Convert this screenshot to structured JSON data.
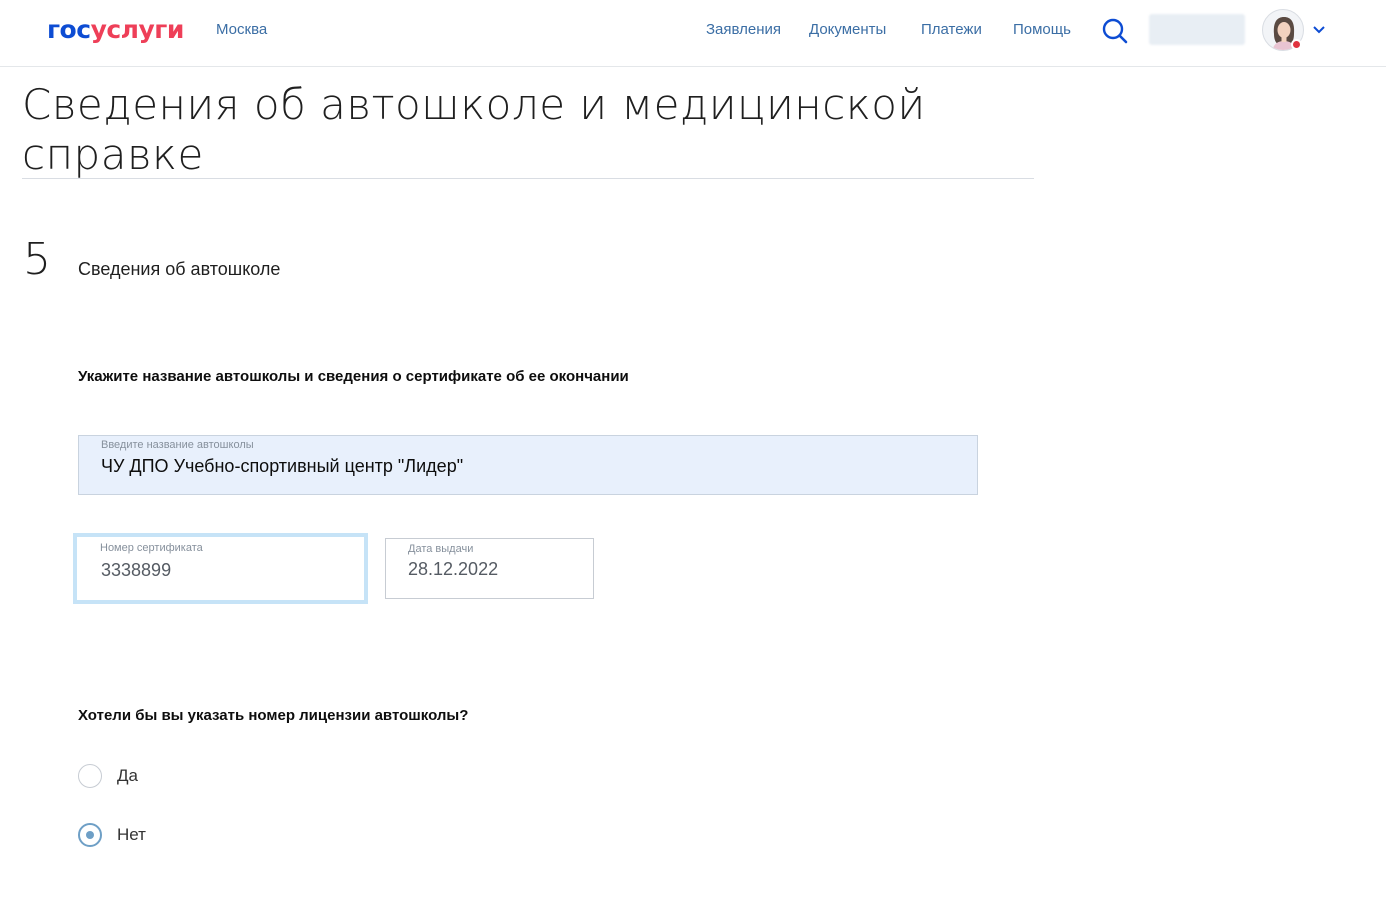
{
  "header": {
    "logo_part1": "гос",
    "logo_part2": "услуги",
    "city": "Москва",
    "nav": [
      "Заявления",
      "Документы",
      "Платежи",
      "Помощь"
    ],
    "icons": [
      "search-icon",
      "avatar",
      "chevron-down-icon"
    ],
    "colors": {
      "brand_blue": "#0d4cd3",
      "brand_red": "#ee3f58",
      "link": "#3b6ea5"
    }
  },
  "page": {
    "title": "Сведения об автошколе и медицинской справке"
  },
  "step": {
    "number": "5",
    "title": "Сведения об автошколе"
  },
  "form": {
    "school_question": "Укажите название автошколы и сведения о сертификате об ее окончании",
    "school_name": {
      "label": "Введите название автошколы",
      "value": "ЧУ ДПО Учебно-спортивный центр \"Лидер\""
    },
    "certificate_number": {
      "label": "Номер сертификата",
      "value": "3338899"
    },
    "issue_date": {
      "label": "Дата выдачи",
      "value": "28.12.2022"
    },
    "license_question": "Хотели бы вы указать номер лицензии автошколы?",
    "options": [
      {
        "label": "Да",
        "checked": false
      },
      {
        "label": "Нет",
        "checked": true
      }
    ]
  }
}
